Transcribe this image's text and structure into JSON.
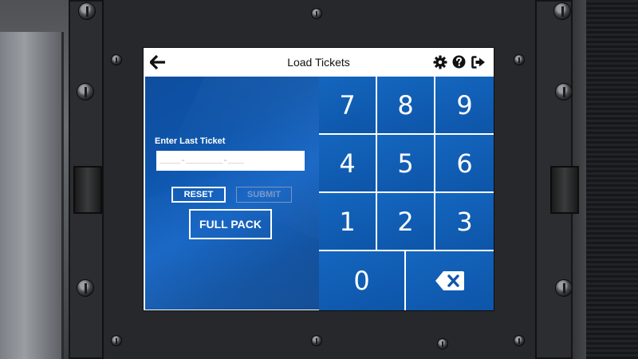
{
  "colors": {
    "panel_blue": "#0d55ab",
    "key_blue": "#1466bf",
    "header_bg": "#ffffff",
    "submit_disabled": "#7b98c6"
  },
  "header": {
    "title": "Load Tickets",
    "back_icon": "arrow-left-icon",
    "settings_icon": "gear-icon",
    "help_icon": "question-circle-icon",
    "logout_icon": "sign-out-icon"
  },
  "form": {
    "label": "Enter Last Ticket",
    "input_value": "____-_______-___",
    "reset_label": "RESET",
    "submit_label": "SUBMIT",
    "submit_enabled": false,
    "full_pack_label": "FULL PACK"
  },
  "keypad": {
    "rows": [
      [
        "7",
        "8",
        "9"
      ],
      [
        "4",
        "5",
        "6"
      ],
      [
        "1",
        "2",
        "3"
      ]
    ],
    "zero": "0",
    "backspace_icon": "backspace-icon"
  }
}
